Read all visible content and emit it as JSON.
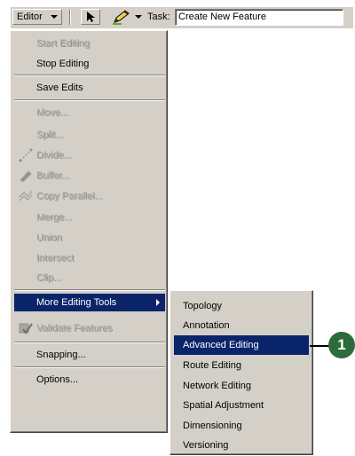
{
  "toolbar": {
    "editor_menu_label": "Editor",
    "task_label": "Task:",
    "task_value": "Create New Feature"
  },
  "editor_menu": {
    "items": [
      {
        "label": "Start Editing",
        "enabled": false
      },
      {
        "label": "Stop Editing",
        "enabled": true
      },
      {
        "label": "Save Edits",
        "enabled": true
      },
      {
        "label": "Move...",
        "enabled": false
      },
      {
        "label": "Split...",
        "enabled": false
      },
      {
        "label": "Divide...",
        "enabled": false,
        "icon": "divide-icon"
      },
      {
        "label": "Buffer...",
        "enabled": false,
        "icon": "buffer-icon"
      },
      {
        "label": "Copy Parallel...",
        "enabled": false,
        "icon": "copy-parallel-icon"
      },
      {
        "label": "Merge...",
        "enabled": false
      },
      {
        "label": "Union",
        "enabled": false
      },
      {
        "label": "Intersect",
        "enabled": false
      },
      {
        "label": "Clip...",
        "enabled": false
      },
      {
        "label": "More Editing Tools",
        "enabled": true,
        "highlighted": true,
        "has_submenu": true
      },
      {
        "label": "Validate Features",
        "enabled": false,
        "icon": "validate-features-icon"
      },
      {
        "label": "Snapping...",
        "enabled": true
      },
      {
        "label": "Options...",
        "enabled": true
      }
    ]
  },
  "submenu": {
    "items": [
      {
        "label": "Topology"
      },
      {
        "label": "Annotation"
      },
      {
        "label": "Advanced Editing",
        "highlighted": true
      },
      {
        "label": "Route Editing"
      },
      {
        "label": "Network Editing"
      },
      {
        "label": "Spatial Adjustment"
      },
      {
        "label": "Dimensioning"
      },
      {
        "label": "Versioning"
      }
    ]
  },
  "callout": {
    "number": "1"
  },
  "colors": {
    "menu_bg": "#d4d0c8",
    "highlight": "#0a246a",
    "callout": "#2e6b3c"
  }
}
